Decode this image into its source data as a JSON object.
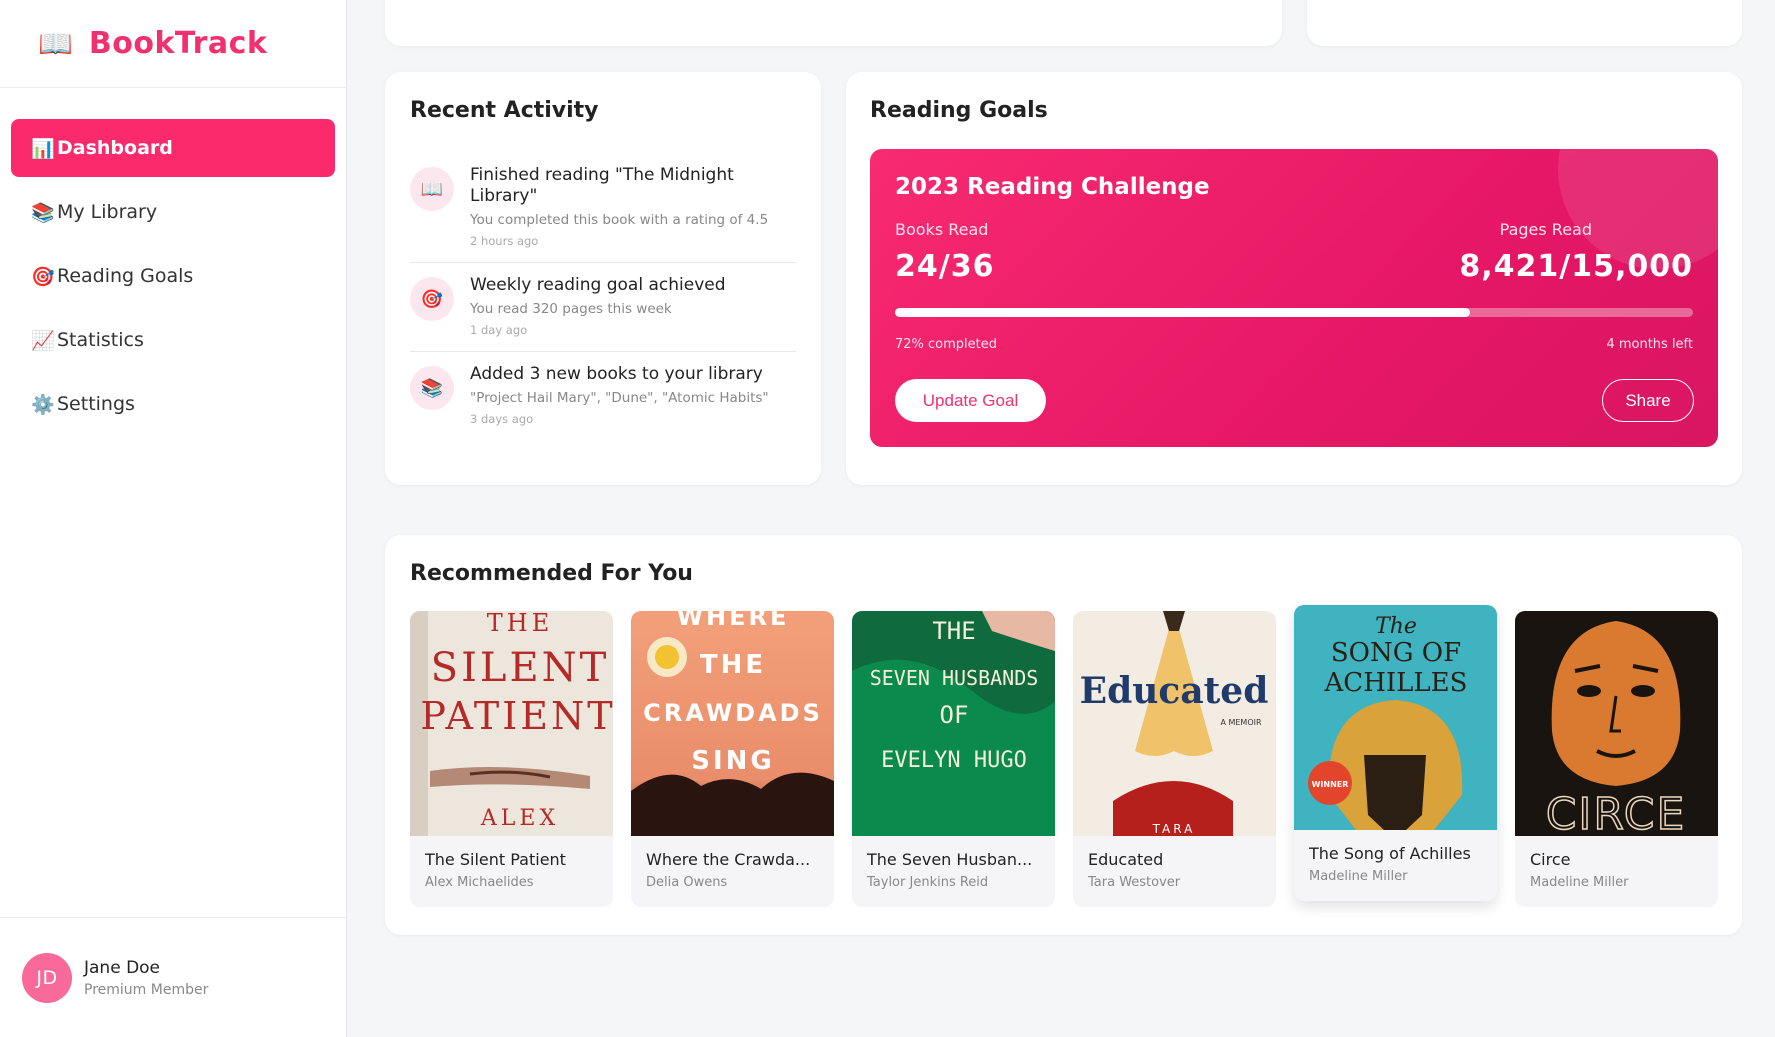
{
  "app": {
    "logo_icon": "📖",
    "name": "BookTrack",
    "brand_color": "#f0306f"
  },
  "sidebar": {
    "items": [
      {
        "icon": "📊",
        "icon_name": "chart-icon",
        "label": "Dashboard",
        "active": true
      },
      {
        "icon": "📚",
        "icon_name": "books-icon",
        "label": "My Library"
      },
      {
        "icon": "🎯",
        "icon_name": "target-icon",
        "label": "Reading Goals"
      },
      {
        "icon": "📈",
        "icon_name": "trend-icon",
        "label": "Statistics"
      },
      {
        "icon": "⚙️",
        "icon_name": "gear-icon",
        "label": "Settings"
      }
    ]
  },
  "user": {
    "initials": "JD",
    "name": "Jane Doe",
    "role": "Premium Member"
  },
  "activity": {
    "title": "Recent Activity",
    "items": [
      {
        "icon": "📖",
        "title": "Finished reading \"The Midnight Library\"",
        "desc": "You completed this book with a rating of 4.5",
        "time": "2 hours ago"
      },
      {
        "icon": "🎯",
        "title": "Weekly reading goal achieved",
        "desc": "You read 320 pages this week",
        "time": "1 day ago"
      },
      {
        "icon": "📚",
        "title": "Added 3 new books to your library",
        "desc": "\"Project Hail Mary\", \"Dune\", \"Atomic Habits\"",
        "time": "3 days ago"
      }
    ]
  },
  "goals": {
    "title": "Reading Goals",
    "challenge_title": "2023 Reading Challenge",
    "books_label": "Books Read",
    "books_value": "24/36",
    "pages_label": "Pages Read",
    "pages_value": "8,421/15,000",
    "progress_fraction": 0.72,
    "completed_text": "72% completed",
    "remaining_text": "4 months left",
    "update_button": "Update Goal",
    "share_button": "Share"
  },
  "recommended": {
    "title": "Recommended For You",
    "books": [
      {
        "title": "The Silent Patient",
        "author": "Alex Michaelides",
        "cover_text": [
          "THE",
          "SILENT",
          "PATIENT",
          "ALEX"
        ]
      },
      {
        "title": "Where the Crawda...",
        "author": "Delia Owens",
        "cover_text": [
          "WHERE",
          "THE",
          "CRAWDADS",
          "SING"
        ]
      },
      {
        "title": "The Seven Husban...",
        "author": "Taylor Jenkins Reid",
        "cover_text": [
          "THE",
          "SEVEN HUSBANDS",
          "OF",
          "EVELYN HUGO"
        ]
      },
      {
        "title": "Educated",
        "author": "Tara Westover",
        "cover_text": [
          "Educated",
          "A MEMOIR",
          "TARA"
        ]
      },
      {
        "title": "The Song of Achilles",
        "author": "Madeline Miller",
        "cover_text": [
          "The",
          "SONG OF",
          "ACHILLES",
          "WINNER"
        ]
      },
      {
        "title": "Circe",
        "author": "Madeline Miller",
        "cover_text": [
          "CIRCE"
        ]
      }
    ]
  }
}
